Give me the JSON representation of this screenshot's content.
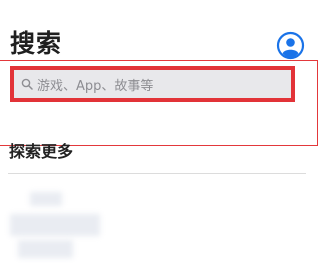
{
  "header": {
    "title": "搜索",
    "account_icon": "person-circle-icon",
    "accent_color": "#1a73e8"
  },
  "search": {
    "placeholder": "游戏、App、故事等",
    "icon": "search-icon",
    "highlight_color": "#e23338"
  },
  "explore": {
    "title": "探索更多"
  }
}
